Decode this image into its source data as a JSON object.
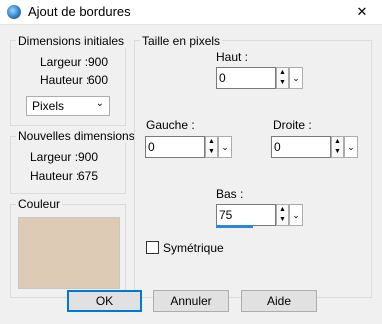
{
  "window": {
    "title": "Ajout de bordures",
    "close": "✕"
  },
  "initial": {
    "legend": "Dimensions initiales",
    "width_label": "Largeur :",
    "width_value": "900",
    "height_label": "Hauteur :",
    "height_value": "600",
    "unit_select": "Pixels"
  },
  "new_dims": {
    "legend": "Nouvelles dimensions",
    "width_label": "Largeur :",
    "width_value": "900",
    "height_label": "Hauteur :",
    "height_value": "675"
  },
  "color": {
    "legend": "Couleur",
    "value": "#ddcbb6"
  },
  "size": {
    "legend": "Taille en pixels",
    "top_label": "Haut :",
    "top_value": "0",
    "left_label": "Gauche :",
    "left_value": "0",
    "right_label": "Droite :",
    "right_value": "0",
    "bottom_label": "Bas :",
    "bottom_value": "75",
    "symmetric_label": "Symétrique",
    "symmetric_checked": false
  },
  "buttons": {
    "ok": "OK",
    "cancel": "Annuler",
    "help": "Aide"
  }
}
